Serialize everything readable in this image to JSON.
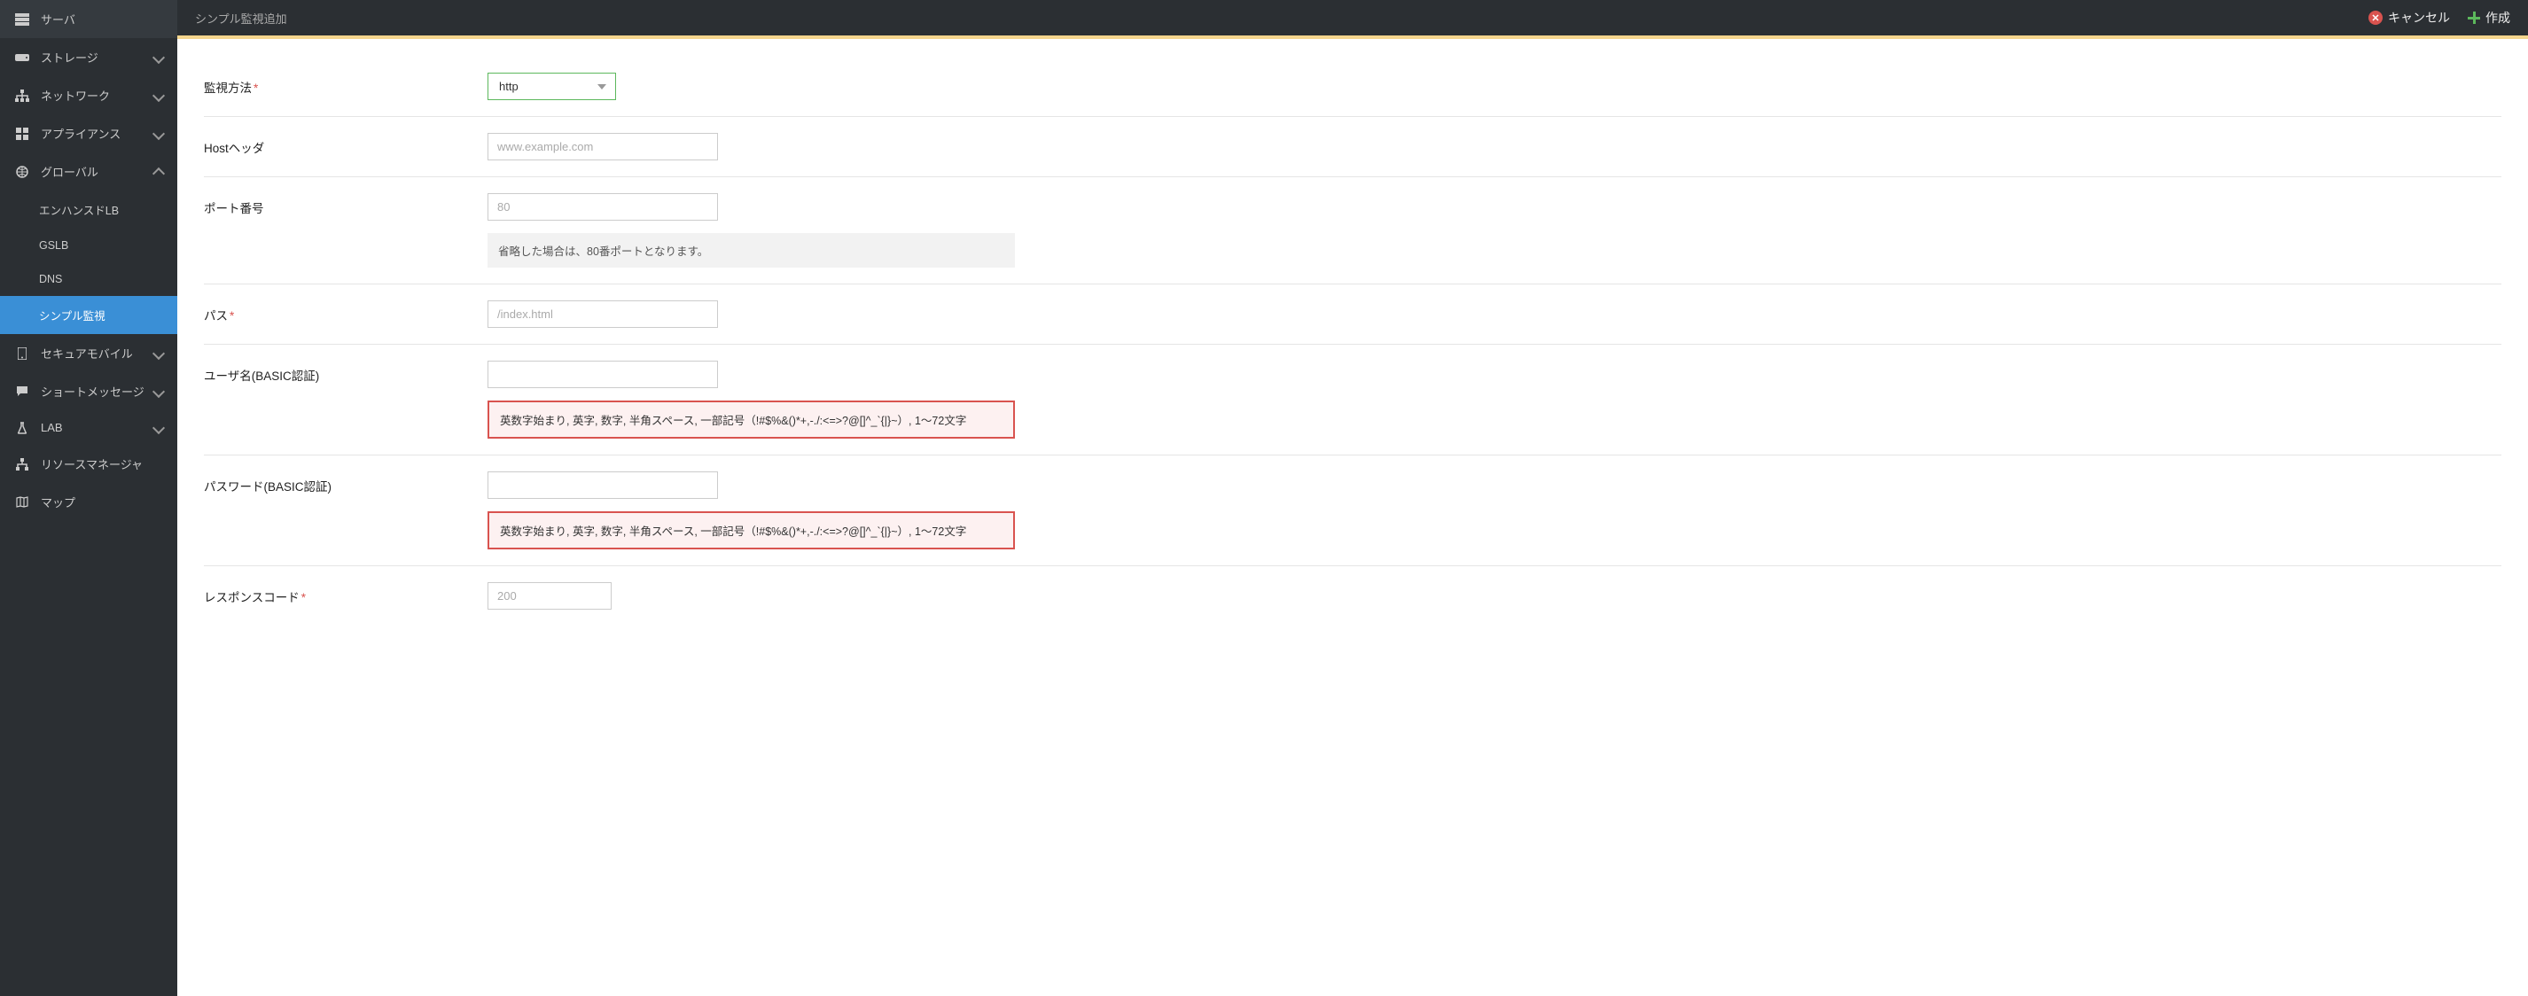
{
  "header": {
    "title": "シンプル監視追加",
    "cancel_label": "キャンセル",
    "create_label": "作成"
  },
  "sidebar": {
    "items": [
      {
        "label": "サーバ"
      },
      {
        "label": "ストレージ"
      },
      {
        "label": "ネットワーク"
      },
      {
        "label": "アプライアンス"
      },
      {
        "label": "グローバル"
      },
      {
        "label": "エンハンスドLB"
      },
      {
        "label": "GSLB"
      },
      {
        "label": "DNS"
      },
      {
        "label": "シンプル監視"
      },
      {
        "label": "セキュアモバイル"
      },
      {
        "label": "ショートメッセージ"
      },
      {
        "label": "LAB"
      },
      {
        "label": "リソースマネージャ"
      },
      {
        "label": "マップ"
      }
    ]
  },
  "form": {
    "monitoring_method": {
      "label": "監視方法",
      "value": "http"
    },
    "host_header": {
      "label": "Hostヘッダ",
      "placeholder": "www.example.com"
    },
    "port": {
      "label": "ポート番号",
      "placeholder": "80",
      "hint": "省略した場合は、80番ポートとなります。"
    },
    "path": {
      "label": "パス",
      "placeholder": "/index.html"
    },
    "basic_user": {
      "label": "ユーザ名(BASIC認証)",
      "hint": "英数字始まり, 英字, 数字, 半角スペース, 一部記号（!#$%&()*+,-./:<=>?@[]^_`{|}~）, 1〜72文字"
    },
    "basic_pass": {
      "label": "パスワード(BASIC認証)",
      "hint": "英数字始まり, 英字, 数字, 半角スペース, 一部記号（!#$%&()*+,-./:<=>?@[]^_`{|}~）, 1〜72文字"
    },
    "response_code": {
      "label": "レスポンスコード",
      "placeholder": "200"
    }
  }
}
